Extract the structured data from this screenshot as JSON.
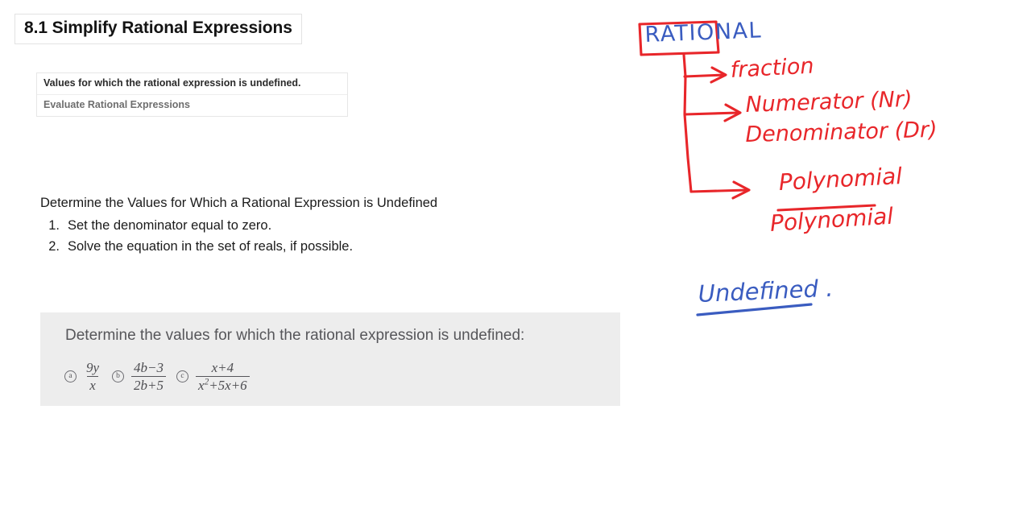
{
  "slide": {
    "title": "8.1 Simplify Rational Expressions",
    "topics": [
      "Values for which the rational expression is undefined.",
      "Evaluate Rational Expressions"
    ],
    "procedure": {
      "heading": "Determine the Values for Which a Rational Expression is Undefined",
      "steps": [
        {
          "number": "1.",
          "text": "Set the denominator equal to zero."
        },
        {
          "number": "2.",
          "text": "Solve the equation in the set of reals, if possible."
        }
      ]
    },
    "example": {
      "prompt": "Determine the values for which the rational expression is undefined:",
      "items": [
        {
          "label": "a",
          "numerator": "9y",
          "denominator": "x"
        },
        {
          "label": "b",
          "numerator": "4b−3",
          "denominator": "2b+5"
        },
        {
          "label": "c",
          "numerator": "x+4",
          "denominator_base": "x",
          "denominator_exp": "2",
          "denominator_rest": "+5x+6"
        }
      ]
    }
  },
  "annotations": {
    "ink_red": "#e8262a",
    "ink_blue": "#3a5cc0",
    "root_label": "RATIONAL",
    "branches": [
      "fraction",
      "Numerator  (Nr)",
      "Denominator (Dr)"
    ],
    "polynomial_numerator": "Polynomial",
    "polynomial_denominator": "Polynomial",
    "undefined_label": "Undefined ."
  }
}
